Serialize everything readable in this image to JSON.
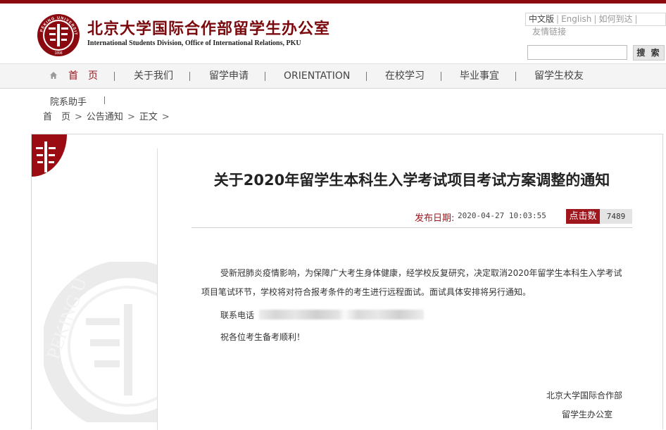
{
  "header": {
    "logo_cn": "北京大学国际合作部留学生办公室",
    "logo_en": "International Students Division, Office of International Relations, PKU",
    "seal_text": "PEKING UNIVERSITY",
    "seal_year": "1898",
    "lang_current": "中文版",
    "lang_english": "English",
    "how_to_get": "如何到达",
    "friend_links": "友情链接",
    "search": {
      "value": "",
      "button": "搜 索"
    }
  },
  "nav": {
    "items": [
      "首　页",
      "关于我们",
      "留学申请",
      "ORIENTATION",
      "在校学习",
      "毕业事宜",
      "留学生校友"
    ],
    "sub_items": [
      "院系助手"
    ]
  },
  "breadcrumb": [
    "首　页",
    "公告通知",
    "正文"
  ],
  "article": {
    "title": "关于2020年留学生本科生入学考试项目考试方案调整的通知",
    "date_label": "发布日期:",
    "date": "2020-04-27 10:03:55",
    "clicks_label": "点击数",
    "clicks": "7489",
    "para1_line1": "受新冠肺炎疫情影响，为保障广大考生身体健康，经学校反复研究，决定取消2020年留学生本科生入学考试",
    "para1_line2": "项目笔试环节，学校将对符合报考条件的考生进行远程面试。面试具体安排将另行通知。",
    "phone_label": "联系电话",
    "closing": "祝各位考生备考顺利！",
    "signature_line1": "北京大学国际合作部",
    "signature_line2": "留学生办公室"
  },
  "colors": {
    "brand_red": "#8b0a0f",
    "accent_red": "#a0161d"
  }
}
